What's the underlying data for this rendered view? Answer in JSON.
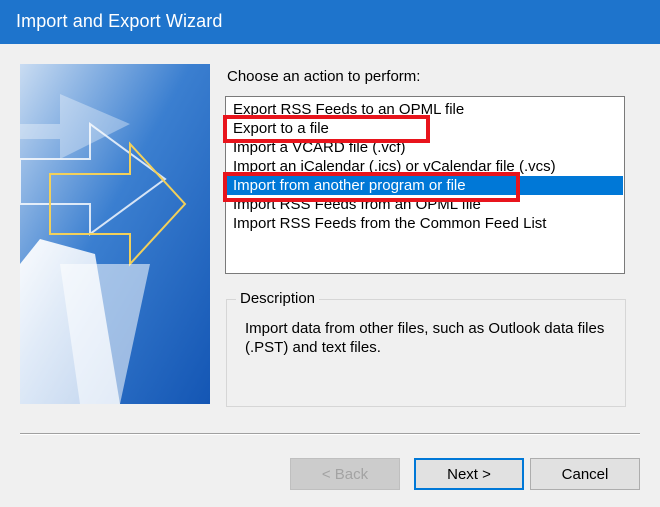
{
  "window": {
    "title": "Import and Export Wizard"
  },
  "prompt": "Choose an action to perform:",
  "actions": [
    {
      "label": "Export RSS Feeds to an OPML file"
    },
    {
      "label": "Export to a file"
    },
    {
      "label": "Import a VCARD file (.vcf)"
    },
    {
      "label": "Import an iCalendar (.ics) or vCalendar file (.vcs)"
    },
    {
      "label": "Import from another program or file"
    },
    {
      "label": "Import RSS Feeds from an OPML file"
    },
    {
      "label": "Import RSS Feeds from the Common Feed List"
    }
  ],
  "selected_action": "Import from another program or file",
  "description": {
    "legend": "Description",
    "text": "Import data from other files, such as Outlook data files (.PST) and text files."
  },
  "buttons": {
    "back": "< Back",
    "next": "Next >",
    "cancel": "Cancel"
  },
  "colors": {
    "titlebar": "#1e74cc",
    "selection": "#0078d7",
    "highlight": "#e8141c"
  }
}
